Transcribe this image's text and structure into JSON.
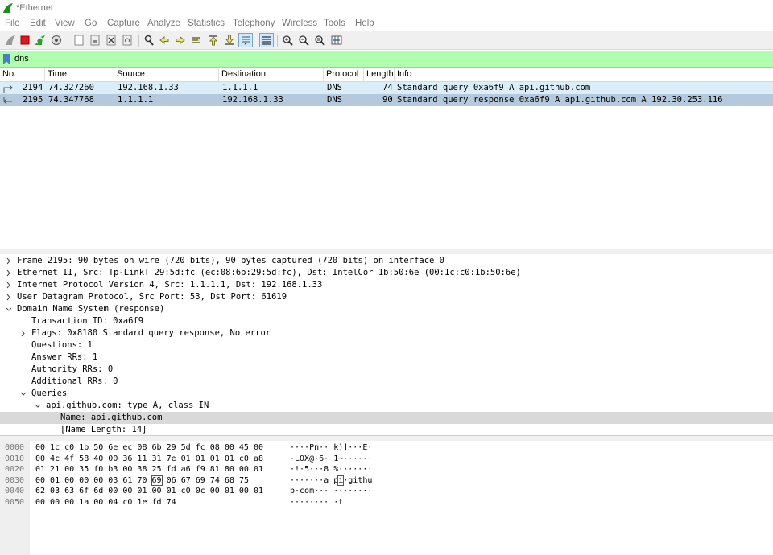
{
  "window": {
    "title": "*Ethernet"
  },
  "menu": [
    "File",
    "Edit",
    "View",
    "Go",
    "Capture",
    "Analyze",
    "Statistics",
    "Telephony",
    "Wireless",
    "Tools",
    "Help"
  ],
  "toolbar": {
    "icons": [
      "shark-fin-start-icon",
      "stop-capture-icon",
      "restart-capture-icon",
      "capture-options-icon",
      "open-file-icon",
      "save-file-icon",
      "close-file-icon",
      "reload-file-icon",
      "find-packet-icon",
      "go-back-icon",
      "go-forward-icon",
      "go-to-packet-icon",
      "go-first-icon",
      "go-last-icon",
      "autoscroll-icon",
      "colorize-icon",
      "zoom-in-icon",
      "zoom-out-icon",
      "zoom-normal-icon",
      "resize-columns-icon"
    ]
  },
  "filter": {
    "value": "dns"
  },
  "packet_list": {
    "columns": [
      "No.",
      "Time",
      "Source",
      "Destination",
      "Protocol",
      "Length",
      "Info"
    ],
    "rows": [
      {
        "no": "2194",
        "time": "74.327260",
        "source": "192.168.1.33",
        "destination": "1.1.1.1",
        "protocol": "DNS",
        "length": "74",
        "info": "Standard query 0xa6f9 A api.github.com"
      },
      {
        "no": "2195",
        "time": "74.347768",
        "source": "1.1.1.1",
        "destination": "192.168.1.33",
        "protocol": "DNS",
        "length": "90",
        "info": "Standard query response 0xa6f9 A api.github.com A 192.30.253.116"
      }
    ]
  },
  "details": [
    {
      "text": "Frame 2195: 90 bytes on wire (720 bits), 90 bytes captured (720 bits) on interface 0",
      "level": 0,
      "toggle": "collapsed"
    },
    {
      "text": "Ethernet II, Src: Tp-LinkT_29:5d:fc (ec:08:6b:29:5d:fc), Dst: IntelCor_1b:50:6e (00:1c:c0:1b:50:6e)",
      "level": 0,
      "toggle": "collapsed"
    },
    {
      "text": "Internet Protocol Version 4, Src: 1.1.1.1, Dst: 192.168.1.33",
      "level": 0,
      "toggle": "collapsed"
    },
    {
      "text": "User Datagram Protocol, Src Port: 53, Dst Port: 61619",
      "level": 0,
      "toggle": "collapsed"
    },
    {
      "text": "Domain Name System (response)",
      "level": 0,
      "toggle": "expanded"
    },
    {
      "text": "Transaction ID: 0xa6f9",
      "level": 1,
      "toggle": "none"
    },
    {
      "text": "Flags: 0x8180 Standard query response, No error",
      "level": 1,
      "toggle": "collapsed"
    },
    {
      "text": "Questions: 1",
      "level": 1,
      "toggle": "none"
    },
    {
      "text": "Answer RRs: 1",
      "level": 1,
      "toggle": "none"
    },
    {
      "text": "Authority RRs: 0",
      "level": 1,
      "toggle": "none"
    },
    {
      "text": "Additional RRs: 0",
      "level": 1,
      "toggle": "none"
    },
    {
      "text": "Queries",
      "level": 1,
      "toggle": "expanded"
    },
    {
      "text": "api.github.com: type A, class IN",
      "level": 2,
      "toggle": "expanded"
    },
    {
      "text": "Name: api.github.com",
      "level": 3,
      "toggle": "none",
      "selected": true
    },
    {
      "text": "[Name Length: 14]",
      "level": 3,
      "toggle": "none"
    }
  ],
  "bytes": [
    {
      "offset": "0000",
      "hex1": "00 1c c0 1b 50 6e ec 08",
      "hex2": "6b 29 5d fc 08 00 45 00",
      "ascii1": "····Pn··",
      "ascii2": "k)]···E·"
    },
    {
      "offset": "0010",
      "hex1": "00 4c 4f 58 40 00 36 11",
      "hex2": "31 7e 01 01 01 01 c0 a8",
      "ascii1": "·LOX@·6·",
      "ascii2": "1~······"
    },
    {
      "offset": "0020",
      "hex1": "01 21 00 35 f0 b3 00 38",
      "hex2": "25 fd a6 f9 81 80 00 01",
      "ascii1": "·!·5···8",
      "ascii2": "%·······"
    },
    {
      "offset": "0030",
      "hex1": "00 01 00 00 00 03 61",
      "hex2": "70 69 06 67 69 74 68 75",
      "ascii1": "·······a",
      "ascii2": "pi·githu",
      "hl_hex": "69",
      "hl_ascii": "i"
    },
    {
      "offset": "0040",
      "hex1": "62 03 63 6f 6d 00 00 01",
      "hex2": "00 01 c0 0c 00 01 00 01",
      "ascii1": "b·com···",
      "ascii2": "········"
    },
    {
      "offset": "0050",
      "hex1": "00 00 00 1a 00 04 c0 1e",
      "hex2": "fd 74",
      "ascii1": "········",
      "ascii2": "·t"
    }
  ]
}
